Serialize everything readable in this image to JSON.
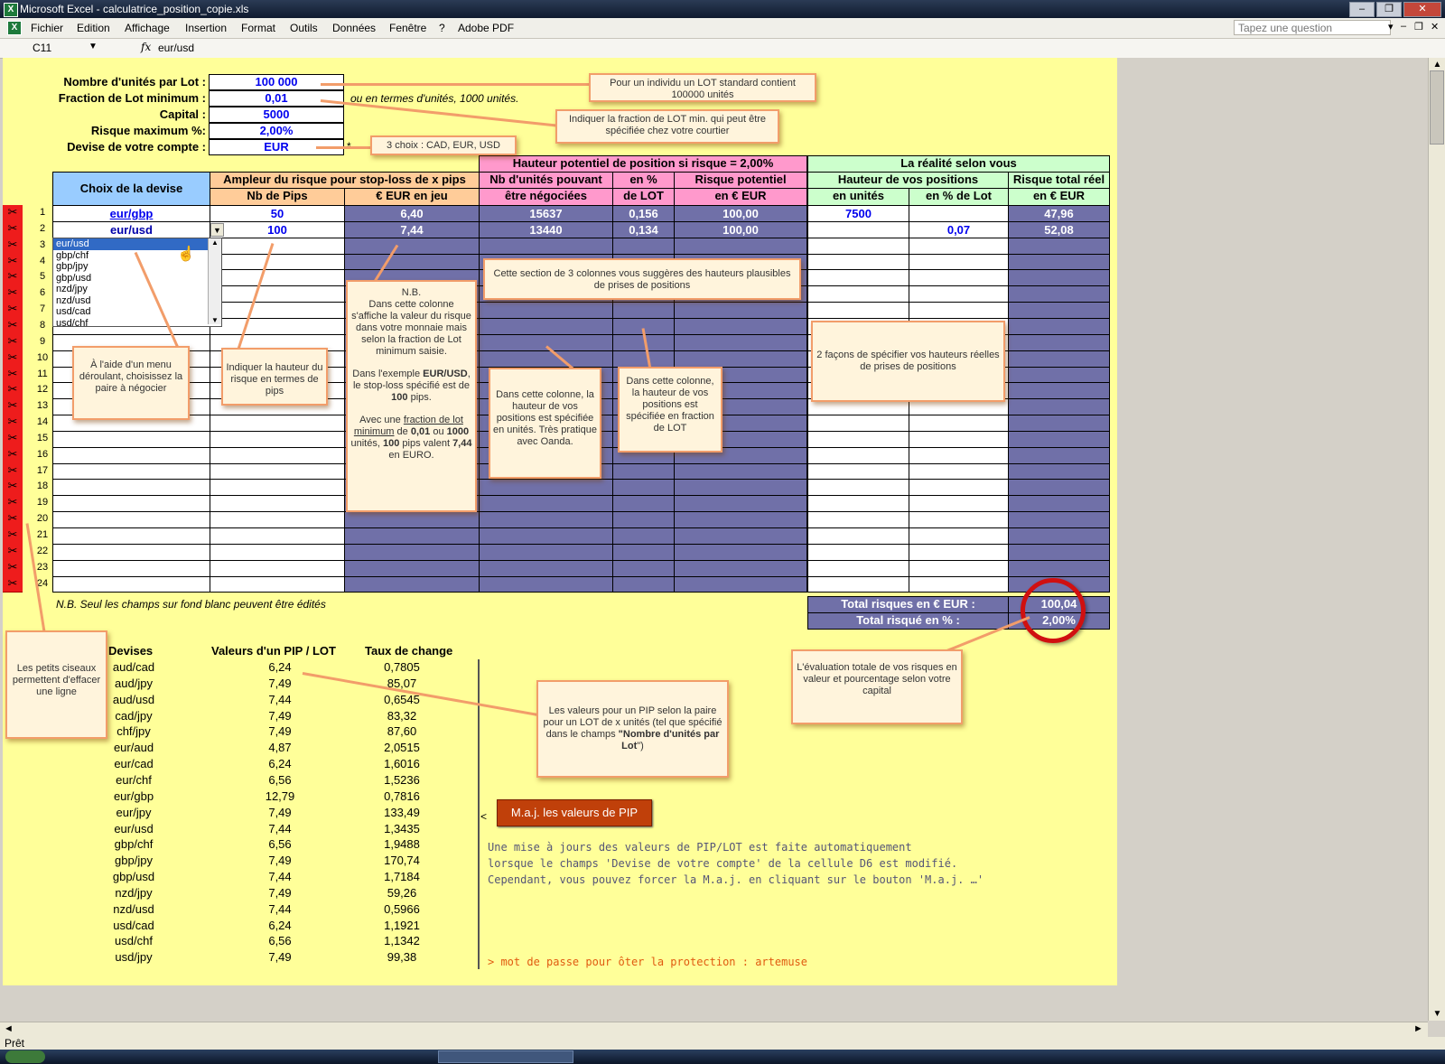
{
  "window": {
    "title": "Microsoft Excel - calculatrice_position_copie.xls"
  },
  "menu": {
    "items": [
      "Fichier",
      "Edition",
      "Affichage",
      "Insertion",
      "Format",
      "Outils",
      "Données",
      "Fenêtre",
      "?",
      "Adobe PDF"
    ],
    "ask_placeholder": "Tapez une question"
  },
  "formula_bar": {
    "cell_ref": "C11",
    "fx": "fx",
    "content": "eur/usd"
  },
  "params": {
    "lot_units": {
      "label": "Nombre d'unités par Lot :",
      "value": "100 000"
    },
    "lot_min": {
      "label": "Fraction de Lot minimum :",
      "value": "0,01",
      "note": "ou en termes d'unités, 1000 unités."
    },
    "capital": {
      "label": "Capital :",
      "value": "5000"
    },
    "risk_max": {
      "label": "Risque maximum %:",
      "value": "2,00%"
    },
    "currency": {
      "label": "Devise de votre compte :",
      "value": "EUR",
      "star": "*"
    }
  },
  "headers": {
    "choix": "Choix de la devise",
    "ampleur": "Ampleur du risque pour stop-loss de x pips",
    "nb_pips": "Nb de Pips",
    "eur_jeu": "€ EUR en jeu",
    "hauteur_pot": "Hauteur potentiel de position si risque = 2,00%",
    "nb_unites_1": "Nb d'unités pouvant",
    "nb_unites_2": "être négociées",
    "en_pct_1": "en %",
    "en_pct_2": "de LOT",
    "risque_pot_1": "Risque potentiel",
    "risque_pot_2": "en € EUR",
    "realite": "La réalité selon vous",
    "hauteur_vos": "Hauteur de vos positions",
    "en_unites": "en unités",
    "en_pct_lot": "en % de Lot",
    "risque_total_1": "Risque total réel",
    "risque_total_2": "en € EUR"
  },
  "rows": [
    {
      "num": "1",
      "pair": "eur/gbp",
      "pips": "50",
      "eur": "6,40",
      "units": "15637",
      "pct": "0,156",
      "risk": "100,00",
      "my_units": "7500",
      "my_pct": "",
      "total": "47,96"
    },
    {
      "num": "2",
      "pair": "eur/usd",
      "pips": "100",
      "eur": "7,44",
      "units": "13440",
      "pct": "0,134",
      "risk": "100,00",
      "my_units": "",
      "my_pct": "0,07",
      "total": "52,08"
    }
  ],
  "row_numbers": [
    "1",
    "2",
    "3",
    "4",
    "5",
    "6",
    "7",
    "8",
    "9",
    "10",
    "11",
    "12",
    "13",
    "14",
    "15",
    "16",
    "17",
    "18",
    "19",
    "20",
    "21",
    "22",
    "23",
    "24"
  ],
  "dropdown": {
    "options": [
      "eur/usd",
      "gbp/chf",
      "gbp/jpy",
      "gbp/usd",
      "nzd/jpy",
      "nzd/usd",
      "usd/cad",
      "usd/chf"
    ],
    "selected": "eur/usd"
  },
  "note_edit": "N.B. Seul les champs sur fond blanc peuvent être édités",
  "totals": {
    "label_eur": "Total risques en € EUR :",
    "value_eur": "100,04",
    "label_pct": "Total risqué en % :",
    "value_pct": "2,00%"
  },
  "pip_table": {
    "headers": [
      "Devises",
      "Valeurs d'un PIP / LOT",
      "Taux de change"
    ],
    "rows": [
      [
        "aud/cad",
        "6,24",
        "0,7805"
      ],
      [
        "aud/jpy",
        "7,49",
        "85,07"
      ],
      [
        "aud/usd",
        "7,44",
        "0,6545"
      ],
      [
        "cad/jpy",
        "7,49",
        "83,32"
      ],
      [
        "chf/jpy",
        "7,49",
        "87,60"
      ],
      [
        "eur/aud",
        "4,87",
        "2,0515"
      ],
      [
        "eur/cad",
        "6,24",
        "1,6016"
      ],
      [
        "eur/chf",
        "6,56",
        "1,5236"
      ],
      [
        "eur/gbp",
        "12,79",
        "0,7816"
      ],
      [
        "eur/jpy",
        "7,49",
        "133,49"
      ],
      [
        "eur/usd",
        "7,44",
        "1,3435"
      ],
      [
        "gbp/chf",
        "6,56",
        "1,9488"
      ],
      [
        "gbp/jpy",
        "7,49",
        "170,74"
      ],
      [
        "gbp/usd",
        "7,44",
        "1,7184"
      ],
      [
        "nzd/jpy",
        "7,49",
        "59,26"
      ],
      [
        "nzd/usd",
        "7,44",
        "0,5966"
      ],
      [
        "usd/cad",
        "6,24",
        "1,1921"
      ],
      [
        "usd/chf",
        "6,56",
        "1,1342"
      ],
      [
        "usd/jpy",
        "7,49",
        "99,38"
      ]
    ]
  },
  "update_button": {
    "arrow": "<",
    "label": "M.a.j. les valeurs de PIP"
  },
  "update_note": [
    "Une mise à jours des valeurs de PIP/LOT est faite automatiquement",
    "lorsque le champs 'Devise de votre compte' de la cellule D6 est modifié.",
    "Cependant, vous pouvez forcer la M.a.j. en cliquant sur le bouton 'M.a.j. …'"
  ],
  "password_note": "> mot de passe pour ôter la protection : artemuse",
  "callouts": {
    "lot_std": "Pour un individu un LOT standard contient 100000 unités",
    "lot_min": "Indiquer la fraction de LOT min. qui peut être spécifiée chez votre courtier",
    "choix3": "3 choix : CAD, EUR, USD",
    "section3": "Cette section de 3 colonnes vous suggères des hauteurs plausibles de prises de positions",
    "menu": "À l'aide d'un menu déroulant, choisissez la paire à négocier",
    "hauteur_pips": "Indiquer la hauteur du risque en termes de pips",
    "nb_title": "N.B.",
    "nb_text": "Dans cette colonne s'affiche la valeur du risque dans votre monnaie mais selon la fraction de Lot minimum saisie.",
    "nb_ex1": "Dans l'exemple",
    "nb_ex_pair": "EUR/USD",
    "nb_ex2": ", le stop-loss spécifié est de",
    "nb_ex_pips": "100",
    "nb_ex3": "pips.",
    "nb_avec": "Avec une",
    "nb_frac": "fraction de lot minimum",
    "nb_de": "de",
    "nb_001": "0,01",
    "nb_ou": "ou",
    "nb_1000": "1000",
    "nb_unites": "unités,",
    "nb_100": "100",
    "nb_pipsval": "pips valent",
    "nb_744": "7,44",
    "nb_euro": "en EURO.",
    "col_units": "Dans cette colonne, la hauteur de vos positions est spécifiée en unités. Très pratique avec Oanda.",
    "col_lot": "Dans cette colonne, la hauteur de vos positions est spécifiée en fraction de LOT",
    "two_ways": "2 façons de spécifier vos hauteurs réelles de prises de positions",
    "scissors": "Les petits ciseaux permettent d'effacer une ligne",
    "pip_values": "Les valeurs pour un PIP selon la paire pour un LOT de x unités (tel que spécifié dans le champs",
    "pip_values_bold": "\"Nombre d'unités par Lot",
    "pip_values_end": "\")",
    "evaluation": "L'évaluation totale de vos risques en valeur et pourcentage selon votre capital"
  },
  "status": "Prêt",
  "colors": {
    "lavender": "#7070a8",
    "yellow": "#ffff99",
    "pink": "#ff99cc",
    "peach": "#ffcc99",
    "blue": "#99ccff",
    "green": "#ccffcc",
    "red": "#ee1c1c"
  }
}
